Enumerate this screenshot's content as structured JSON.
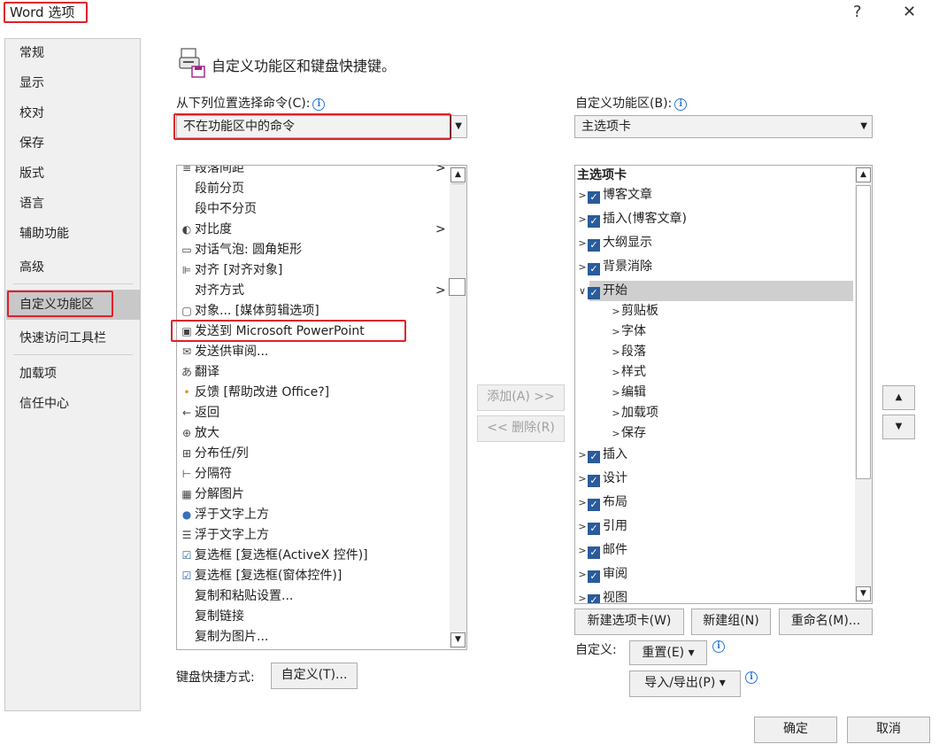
{
  "window": {
    "title": "Word 选项",
    "help_glyph": "?",
    "close_glyph": "✕"
  },
  "nav": {
    "items": [
      "常规",
      "显示",
      "校对",
      "保存",
      "版式",
      "语言",
      "辅助功能",
      "高级",
      "自定义功能区",
      "快速访问工具栏",
      "加载项",
      "信任中心"
    ],
    "selected": "自定义功能区"
  },
  "header": {
    "title": "自定义功能区和键盘快捷键。"
  },
  "left": {
    "label": "从下列位置选择命令(C):",
    "combo_value": "不在功能区中的命令",
    "commands": [
      {
        "label": "段落间距",
        "icon": "paragraph-spacing-icon",
        "arrow": ">"
      },
      {
        "label": "段前分页",
        "icon": ""
      },
      {
        "label": "段中不分页",
        "icon": ""
      },
      {
        "label": "对比度",
        "icon": "contrast-icon",
        "arrow": ">"
      },
      {
        "label": "对话气泡: 圆角矩形",
        "icon": "speech-bubble-icon"
      },
      {
        "label": "对齐 [对齐对象]",
        "icon": "align-objects-icon"
      },
      {
        "label": "对齐方式",
        "icon": "",
        "arrow": ">"
      },
      {
        "label": "对象... [媒体剪辑选项]",
        "icon": "object-icon"
      },
      {
        "label": "发送到 Microsoft PowerPoint",
        "icon": "send-to-powerpoint-icon"
      },
      {
        "label": "发送供审阅...",
        "icon": "send-for-review-icon"
      },
      {
        "label": "翻译",
        "icon": "translate-icon"
      },
      {
        "label": "反馈 [帮助改进 Office?]",
        "icon": "feedback-dot-icon"
      },
      {
        "label": "返回",
        "icon": "back-arrow-icon"
      },
      {
        "label": "放大",
        "icon": "zoom-in-icon"
      },
      {
        "label": "分布任/列",
        "icon": "distribute-icon"
      },
      {
        "label": "分隔符",
        "icon": "separator-icon"
      },
      {
        "label": "分解图片",
        "icon": "ungroup-picture-icon"
      },
      {
        "label": "浮于文字上方",
        "icon": "float-above-text-icon"
      },
      {
        "label": "浮于文字上方",
        "icon": "float-above-text-2-icon"
      },
      {
        "label": "复选框 [复选框(ActiveX 控件)]",
        "icon": "checkbox-icon"
      },
      {
        "label": "复选框 [复选框(窗体控件)]",
        "icon": "checkbox-icon"
      },
      {
        "label": "复制和粘贴设置...",
        "icon": ""
      },
      {
        "label": "复制链接",
        "icon": ""
      },
      {
        "label": "复制为图片...",
        "icon": ""
      }
    ],
    "keyboard_label": "键盘快捷方式:",
    "keyboard_button": "自定义(T)..."
  },
  "middle": {
    "add_button": "添加(A) >>",
    "remove_button": "<< 删除(R)"
  },
  "right": {
    "label": "自定义功能区(B):",
    "combo_value": "主选项卡",
    "tree_header": "主选项卡",
    "tabs_before": [
      "博客文章",
      "插入(博客文章)",
      "大纲显示",
      "背景消除"
    ],
    "expanded_tab": "开始",
    "groups": [
      "剪贴板",
      "字体",
      "段落",
      "样式",
      "编辑",
      "加载项",
      "保存"
    ],
    "tabs_after": [
      "插入",
      "设计",
      "布局",
      "引用",
      "邮件",
      "审阅",
      "视图"
    ],
    "new_tab_button": "新建选项卡(W)",
    "new_group_button": "新建组(N)",
    "rename_button": "重命名(M)...",
    "customize_label": "自定义:",
    "reset_button": "重置(E) ▾",
    "import_export_button": "导入/导出(P) ▾"
  },
  "footer": {
    "ok_button": "确定",
    "cancel_button": "取消"
  }
}
